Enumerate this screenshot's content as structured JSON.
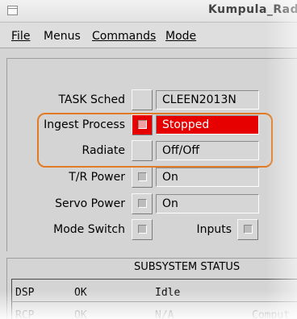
{
  "window": {
    "title": "Kumpula_Rada"
  },
  "menubar": [
    {
      "label": "File"
    },
    {
      "label": "Menus"
    },
    {
      "label": "Commands"
    },
    {
      "label": "Mode"
    }
  ],
  "controls": {
    "task_sched": {
      "label": "TASK Sched",
      "value": "CLEEN2013N"
    },
    "ingest_process": {
      "label": "Ingest Process",
      "value": "Stopped",
      "status_color": "#e60000"
    },
    "radiate": {
      "label": "Radiate",
      "value": "Off/Off"
    },
    "tr_power": {
      "label": "T/R Power",
      "value": "On"
    },
    "servo_power": {
      "label": "Servo Power",
      "value": "On"
    },
    "mode_switch": {
      "label": "Mode Switch"
    },
    "inputs": {
      "label": "Inputs"
    }
  },
  "subsystem_status": {
    "title": "SUBSYSTEM STATUS",
    "rows": [
      {
        "name": "DSP",
        "status": "OK",
        "state": "Idle",
        "extra": ""
      },
      {
        "name": "RCP",
        "status": "OK",
        "state": "N/A",
        "extra": "Comput"
      }
    ]
  },
  "highlight_color": "#e07b24"
}
